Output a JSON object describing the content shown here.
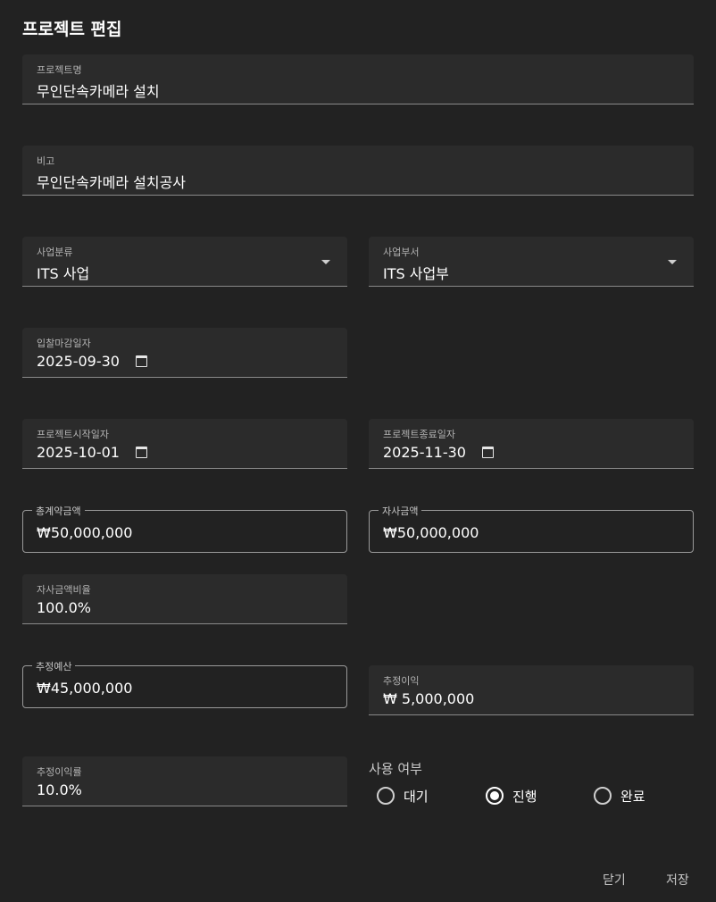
{
  "dialog": {
    "title": "프로젝트 편집",
    "fields": {
      "project_name": {
        "label": "프로젝트명",
        "value": "무인단속카메라 설치"
      },
      "note": {
        "label": "비고",
        "value": "무인단속카메라 설치공사"
      },
      "business_type": {
        "label": "사업분류",
        "value": "ITS 사업"
      },
      "department": {
        "label": "사업부서",
        "value": "ITS 사업부"
      },
      "bid_deadline": {
        "label": "입찰마감일자",
        "value": "2025-09-30"
      },
      "start_date": {
        "label": "프로젝트시작일자",
        "value": "2025-10-01"
      },
      "end_date": {
        "label": "프로젝트종료일자",
        "value": "2025-11-30"
      },
      "total_contract": {
        "label": "총계약금액",
        "value": "₩50,000,000"
      },
      "own_amount": {
        "label": "자사금액",
        "value": "₩50,000,000"
      },
      "own_ratio": {
        "label": "자사금액비율",
        "value": "100.0%"
      },
      "est_budget": {
        "label": "추정예산",
        "value": "₩45,000,000"
      },
      "est_profit": {
        "label": "추정이익",
        "value": "₩ 5,000,000"
      },
      "est_profit_rate": {
        "label": "추정이익률",
        "value": "10.0%"
      }
    },
    "status": {
      "label": "사용 여부",
      "options": [
        {
          "label": "대기",
          "selected": false
        },
        {
          "label": "진행",
          "selected": true
        },
        {
          "label": "완료",
          "selected": false
        }
      ]
    },
    "actions": {
      "close": "닫기",
      "save": "저장"
    },
    "icons": {
      "select": "chevron-down-icon",
      "date": "calendar-icon"
    }
  }
}
